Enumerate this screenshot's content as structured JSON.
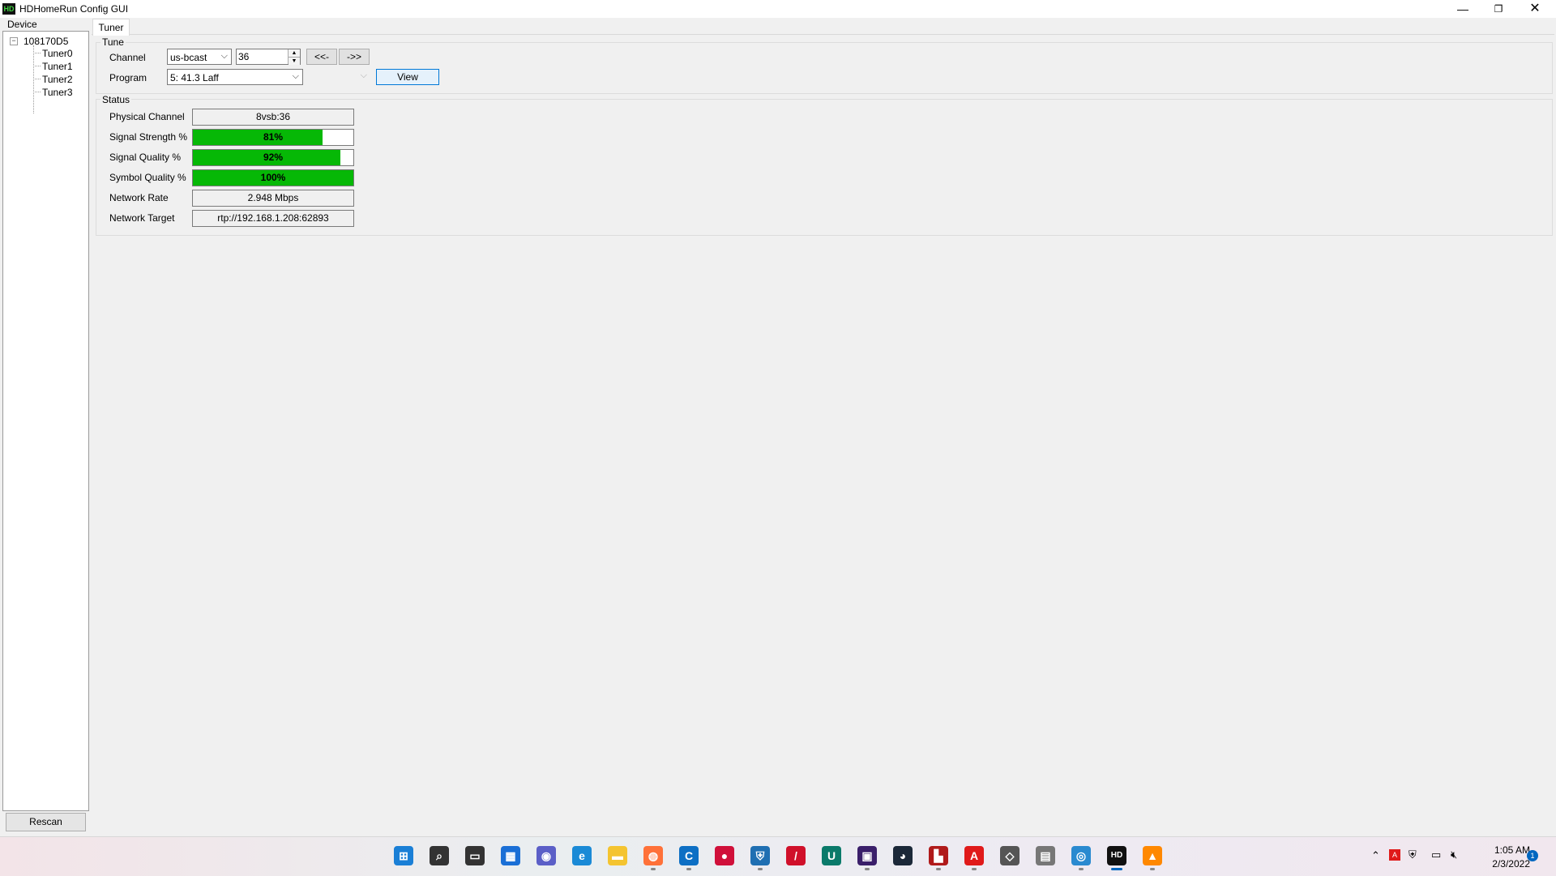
{
  "window": {
    "icon_text": "HD",
    "title": "HDHomeRun Config GUI",
    "controls": {
      "minimize": "—",
      "maximize": "❐",
      "close": "✕"
    }
  },
  "device_panel": {
    "label": "Device",
    "tree": {
      "toggle": "−",
      "root": "108170D5",
      "items": [
        "Tuner0",
        "Tuner1",
        "Tuner2",
        "Tuner3"
      ]
    },
    "rescan_label": "Rescan"
  },
  "tabs": [
    {
      "label": "Tuner",
      "selected": true
    }
  ],
  "tune": {
    "group_title": "Tune",
    "channel_label": "Channel",
    "channel_map": "us-bcast",
    "channel_number": "36",
    "prev_label": "<<-",
    "next_label": "->>",
    "program_label": "Program",
    "program_value": "5: 41.3 Laff",
    "secondary_value": "",
    "view_label": "View"
  },
  "status": {
    "group_title": "Status",
    "physical_channel_label": "Physical Channel",
    "physical_channel": "8vsb:36",
    "signal_strength_label": "Signal Strength %",
    "signal_strength": 81,
    "signal_strength_text": "81%",
    "signal_quality_label": "Signal Quality %",
    "signal_quality": 92,
    "signal_quality_text": "92%",
    "symbol_quality_label": "Symbol Quality %",
    "symbol_quality": 100,
    "symbol_quality_text": "100%",
    "network_rate_label": "Network Rate",
    "network_rate": "2.948 Mbps",
    "network_target_label": "Network Target",
    "network_target": "rtp://192.168.1.208:62893",
    "bar_color": "#06b806"
  },
  "taskbar": {
    "apps": [
      {
        "name": "start-icon",
        "color": "#1a7fd6",
        "glyph": "⊞"
      },
      {
        "name": "search-icon",
        "color": "#333333",
        "glyph": "⌕"
      },
      {
        "name": "task-view-icon",
        "color": "#333333",
        "glyph": "▭"
      },
      {
        "name": "widgets-icon",
        "color": "#1a6fd6",
        "glyph": "▦"
      },
      {
        "name": "teams-chat-icon",
        "color": "#5b5fc7",
        "glyph": "◉"
      },
      {
        "name": "edge-icon",
        "color": "#1a8ad6",
        "glyph": "e"
      },
      {
        "name": "file-explorer-icon",
        "color": "#f4c430",
        "glyph": "▬"
      },
      {
        "name": "firefox-icon",
        "color": "#ff7139",
        "glyph": "◍"
      },
      {
        "name": "app-c-icon",
        "color": "#0d6fc4",
        "glyph": "C"
      },
      {
        "name": "camera-app-icon",
        "color": "#d0103a",
        "glyph": "●"
      },
      {
        "name": "shield-app-icon",
        "color": "#1f6fb2",
        "glyph": "⛨"
      },
      {
        "name": "media-app-icon",
        "color": "#d0102a",
        "glyph": "/"
      },
      {
        "name": "app-u-icon",
        "color": "#0a7a6a",
        "glyph": "U"
      },
      {
        "name": "video-editor-icon",
        "color": "#3a1f6a",
        "glyph": "▣"
      },
      {
        "name": "steam-icon",
        "color": "#1b2838",
        "glyph": "◕"
      },
      {
        "name": "truck-app-icon",
        "color": "#b01a1a",
        "glyph": "▙"
      },
      {
        "name": "adobe-icon",
        "color": "#e01a1a",
        "glyph": "A"
      },
      {
        "name": "layers-app-icon",
        "color": "#555555",
        "glyph": "◇"
      },
      {
        "name": "calendar-app-icon",
        "color": "#777777",
        "glyph": "▤"
      },
      {
        "name": "globe-app-icon",
        "color": "#2a8ad0",
        "glyph": "◎"
      },
      {
        "name": "hdhomerun-icon",
        "color": "#111111",
        "glyph": "HD"
      },
      {
        "name": "vlc-icon",
        "color": "#ff8800",
        "glyph": "▲"
      }
    ],
    "clock_time": "1:05 AM",
    "clock_date": "2/3/2022",
    "notification_count": "1"
  }
}
